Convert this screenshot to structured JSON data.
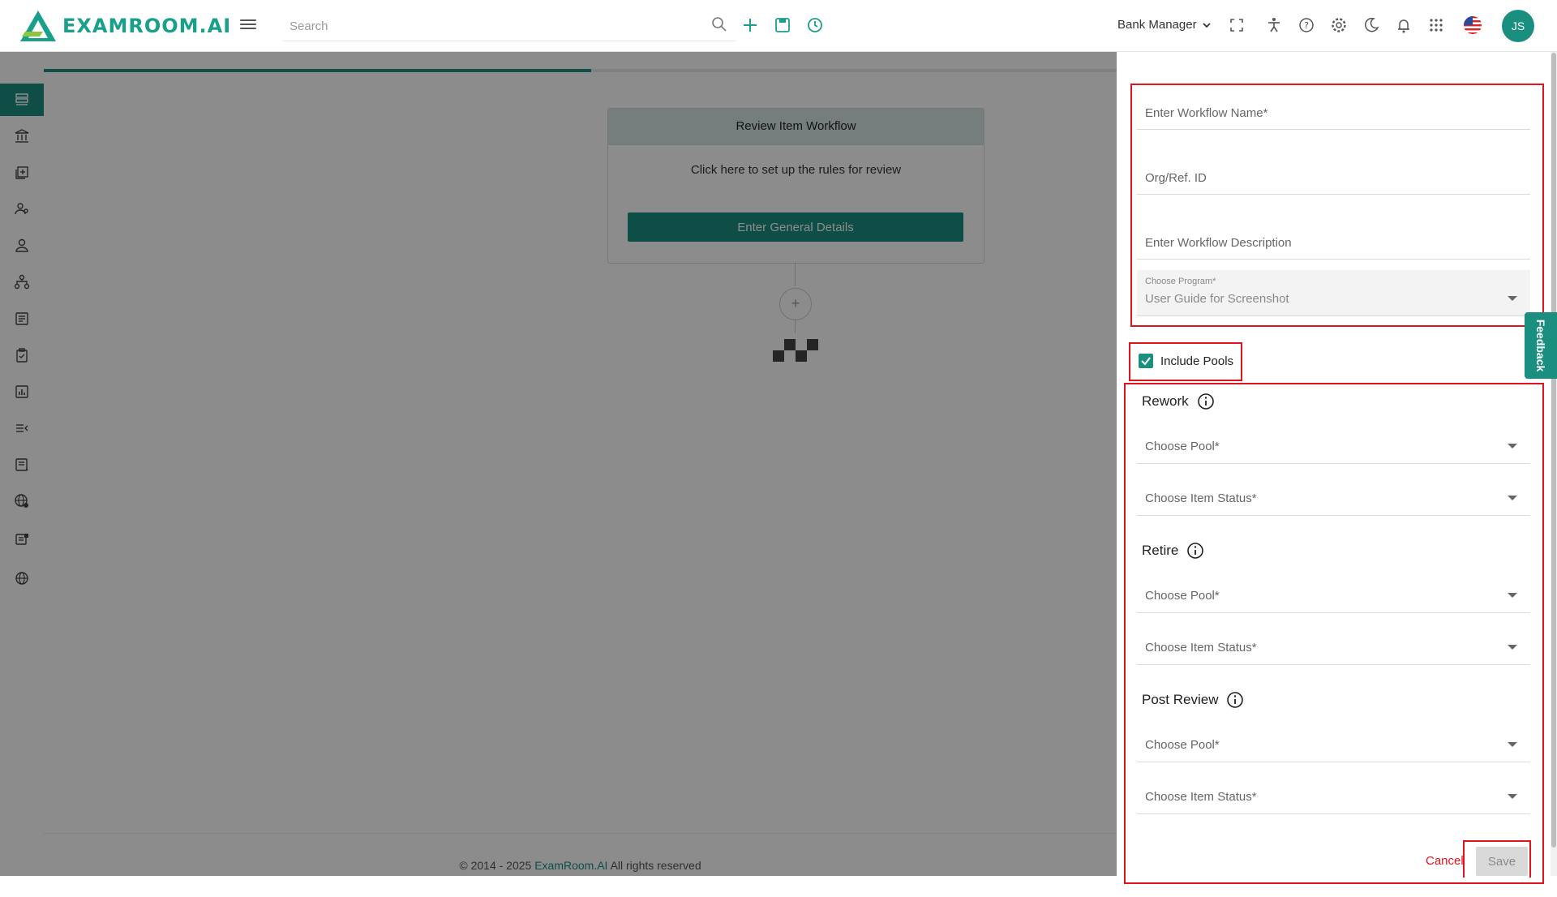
{
  "app": {
    "logo_text": "EXAMROOM.AI",
    "brand_color": "#1a8f80"
  },
  "header": {
    "search_placeholder": "Search",
    "role": "Bank Manager",
    "avatar_initials": "JS",
    "icons": [
      "search-icon",
      "plus-icon",
      "save-icon",
      "history-icon",
      "fullscreen-icon",
      "accessibility-icon",
      "help-icon",
      "settings-icon",
      "dark-mode-icon",
      "notification-icon",
      "apps-grid-icon",
      "us-flag-icon"
    ]
  },
  "sidebar": {
    "items": [
      {
        "icon": "dashboard-icon",
        "active": true
      },
      {
        "icon": "bank-icon",
        "active": false
      },
      {
        "icon": "add-item-icon",
        "active": false
      },
      {
        "icon": "users-icon",
        "active": false
      },
      {
        "icon": "user-icon",
        "active": false
      },
      {
        "icon": "hierarchy-icon",
        "active": false
      },
      {
        "icon": "form-icon",
        "active": false
      },
      {
        "icon": "clipboard-icon",
        "active": false
      },
      {
        "icon": "report-icon",
        "active": false
      },
      {
        "icon": "list-icon",
        "active": false
      },
      {
        "icon": "document-list-icon",
        "active": false
      },
      {
        "icon": "globe-settings-icon",
        "active": false
      },
      {
        "icon": "news-icon",
        "active": false
      },
      {
        "icon": "globe-icon",
        "active": false
      }
    ]
  },
  "workflow": {
    "progress_fraction": 0.51,
    "card_title": "Review Item Workflow",
    "card_text": "Click here to set up the rules for review",
    "card_button": "Enter General Details",
    "add_label": "+"
  },
  "footer": {
    "prefix": "© 2014 - 2025 ",
    "brand": "ExamRoom.AI",
    "suffix": " All rights reserved"
  },
  "form": {
    "workflow_name_placeholder": "Enter Workflow Name*",
    "org_ref_placeholder": "Org/Ref. ID",
    "description_placeholder": "Enter Workflow Description",
    "program_label": "Choose Program*",
    "program_value": "User Guide for Screenshot",
    "include_pools_label": "Include Pools",
    "include_pools_checked": true,
    "sections": {
      "rework": {
        "title": "Rework",
        "pool_label": "Choose Pool*",
        "status_label": "Choose Item Status*"
      },
      "retire": {
        "title": "Retire",
        "pool_label": "Choose Pool*",
        "status_label": "Choose Item Status*"
      },
      "post_review": {
        "title": "Post Review",
        "pool_label": "Choose Pool*",
        "status_label": "Choose Item Status*"
      }
    },
    "cancel_label": "Cancel",
    "save_label": "Save"
  },
  "feedback_label": "Feedback"
}
